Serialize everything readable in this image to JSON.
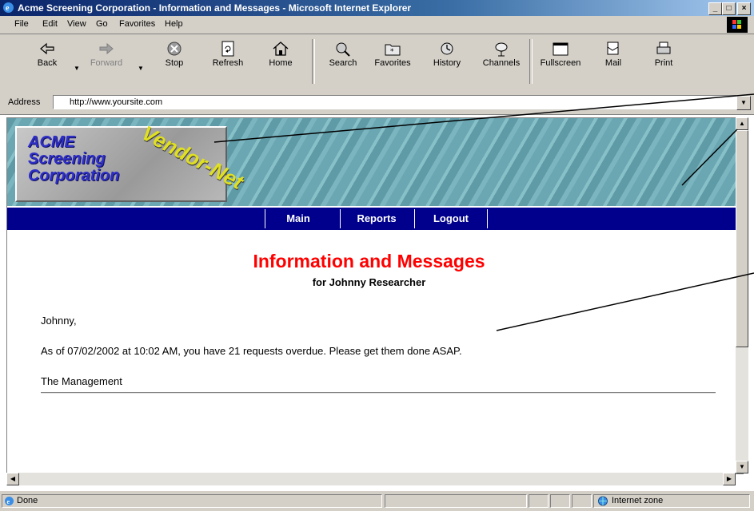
{
  "window": {
    "title": "Acme Screening Corporation - Information and Messages - Microsoft Internet Explorer",
    "min_label": "_",
    "max_label": "□",
    "close_label": "×"
  },
  "menu": [
    "File",
    "Edit",
    "View",
    "Go",
    "Favorites",
    "Help"
  ],
  "toolbar": {
    "back": "Back",
    "forward": "Forward",
    "stop": "Stop",
    "refresh": "Refresh",
    "home": "Home",
    "search": "Search",
    "favorites": "Favorites",
    "history": "History",
    "channels": "Channels",
    "fullscreen": "Fullscreen",
    "mail": "Mail",
    "print": "Print"
  },
  "address": {
    "label": "Address",
    "url": "http://www.yoursite.com"
  },
  "banner": {
    "logo_line1": "ACME",
    "logo_line2": "Screening",
    "logo_line3": "Corporation",
    "logo_badge": "Vendor-Net"
  },
  "nav": [
    "Main",
    "Reports",
    "Logout"
  ],
  "content": {
    "title": "Information and Messages",
    "subtitle": "for Johnny Researcher",
    "greeting": "Johnny,",
    "message": "As of 07/02/2002 at 10:02 AM, you have 21 requests overdue. Please get them done ASAP.",
    "signature": "The Management"
  },
  "status": {
    "text": "Done",
    "zone": "Internet zone"
  },
  "colors": {
    "nav_background": "#00008c",
    "title_color": "#ff0000"
  }
}
